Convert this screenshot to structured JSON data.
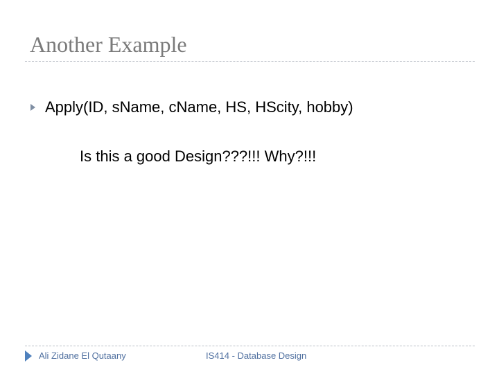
{
  "slide": {
    "title": "Another Example",
    "bullets": [
      {
        "text": "Apply(ID, sName, cName, HS, HScity, hobby)"
      }
    ],
    "subtext": "Is this a good Design???!!! Why?!!!"
  },
  "footer": {
    "author": "Ali Zidane El Qutaany",
    "course": "IS414 - Database Design"
  },
  "colors": {
    "title": "#7a7a7a",
    "bullet_arrow": "#7f8ea3",
    "footer_text": "#4f6f9f",
    "footer_arrow": "#4f81bd",
    "rule": "#b9bec6"
  },
  "icons": {
    "bullet": "triangle-right-icon",
    "footer": "triangle-right-icon"
  }
}
